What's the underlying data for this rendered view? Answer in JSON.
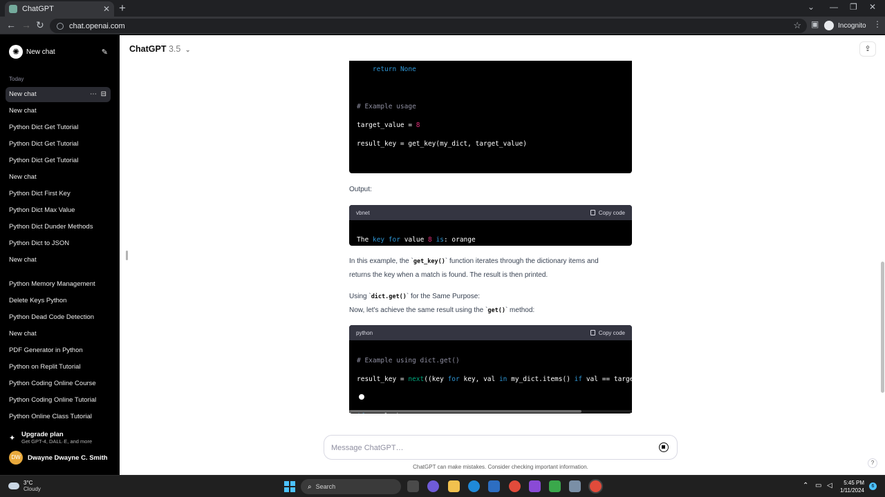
{
  "browser": {
    "tab_title": "ChatGPT",
    "url": "chat.openai.com",
    "profile": "Incognito"
  },
  "sidebar": {
    "new_chat": "New chat",
    "section": "Today",
    "items": [
      {
        "label": "New chat"
      },
      {
        "label": "New chat"
      },
      {
        "label": "Python Dict Get Tutorial"
      },
      {
        "label": "Python Dict Get Tutorial"
      },
      {
        "label": "Python Dict Get Tutorial"
      },
      {
        "label": "New chat"
      },
      {
        "label": "Python Dict First Key"
      },
      {
        "label": "Python Dict Max Value"
      },
      {
        "label": "Python Dict Dunder Methods"
      },
      {
        "label": "Python Dict to JSON"
      },
      {
        "label": "New chat"
      },
      {
        "label": "Python Memory Management"
      },
      {
        "label": "Delete Keys Python"
      },
      {
        "label": "Python Dead Code Detection"
      },
      {
        "label": "New chat"
      },
      {
        "label": "PDF Generator in Python"
      },
      {
        "label": "Python on Replit Tutorial"
      },
      {
        "label": "Python Coding Online Course"
      },
      {
        "label": "Python Coding Online Tutorial"
      },
      {
        "label": "Python Online Class Tutorial"
      }
    ],
    "upgrade_title": "Upgrade plan",
    "upgrade_sub": "Get GPT-4, DALL·E, and more",
    "user_initials": "DW",
    "user_name": "Dwayne Dwayne C. Smith"
  },
  "header": {
    "model": "ChatGPT",
    "version": "3.5"
  },
  "content": {
    "output_label": "Output:",
    "block2_lang": "vbnet",
    "block3_lang": "python",
    "copy_label": "Copy code",
    "para1_a": "In this example, the `",
    "para1_code": "get_key()",
    "para1_b": "` function iterates through the dictionary items and",
    "para1_c": "returns the key when a match is found. The result is then printed.",
    "para2_a": "Using `",
    "para2_code": "dict.get()",
    "para2_b": "` for the Same Purpose:",
    "para3_a": "Now, let's achieve the same result using the `",
    "para3_code": "get()",
    "para3_b": "` method:"
  },
  "composer": {
    "placeholder": "Message ChatGPT…",
    "disclaimer": "ChatGPT can make mistakes. Consider checking important information."
  },
  "taskbar": {
    "temp": "3°C",
    "weather": "Cloudy",
    "search": "Search",
    "time": "5:45 PM",
    "date": "1/11/2024",
    "notifications": "6"
  }
}
